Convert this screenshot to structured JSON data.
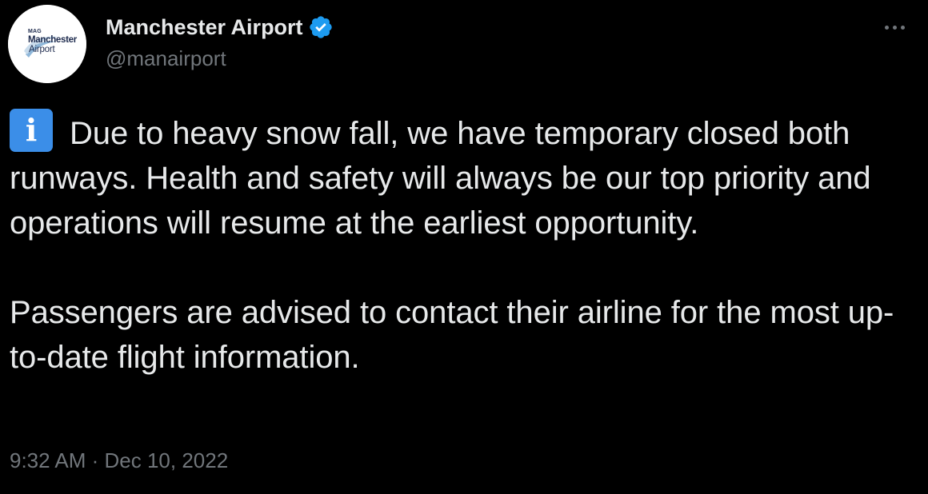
{
  "author": {
    "avatar_logo": {
      "top": "MAG",
      "line1": "Manchester",
      "line2": "Airport"
    },
    "display_name": "Manchester Airport",
    "handle": "@manairport",
    "verified": true,
    "verified_color": "#1d9bf0"
  },
  "tweet": {
    "info_emoji": "i",
    "paragraph1": "Due to heavy snow fall, we have temporary closed both runways. Health and safety will always be our top priority and operations will resume at the earliest opportunity.",
    "paragraph2": "Passengers are advised to contact their airline for the most up-to-date flight information.",
    "time": "9:32 AM",
    "separator": " · ",
    "date": "Dec 10, 2022"
  },
  "icons": {
    "more": "more-options-icon",
    "verified": "verified-badge-icon",
    "info": "information-emoji-icon"
  },
  "colors": {
    "background": "#000000",
    "text": "#e7e9ea",
    "secondary": "#71767b",
    "info_emoji": "#3b8ee8"
  }
}
